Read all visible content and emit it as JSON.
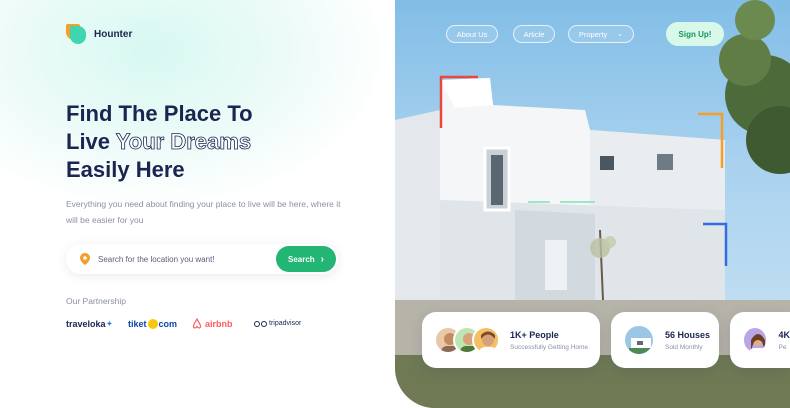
{
  "brand": {
    "name": "Hounter"
  },
  "nav": {
    "items": [
      {
        "label": "About Us"
      },
      {
        "label": "Article"
      },
      {
        "label": "Property"
      }
    ],
    "signup_label": "Sign Up!"
  },
  "hero": {
    "title_line1": "Find The Place To",
    "title_line2_plain": "Live",
    "title_line2_outline": "Your Dreams",
    "title_line3": "Easily Here",
    "description": "Everything you need about finding your place to live will be here, where it will be easier for you"
  },
  "search": {
    "placeholder": "Search for the location you want!",
    "button_label": "Search"
  },
  "partnership": {
    "label": "Our Partnership",
    "partners": [
      "traveloka",
      "tiket",
      "com",
      "airbnb",
      "tripadvisor"
    ]
  },
  "stats": [
    {
      "value": "1K+ People",
      "caption": "Successfully Getting Home"
    },
    {
      "value": "56 Houses",
      "caption": "Sold Monthly"
    },
    {
      "value": "4K",
      "caption": "Pe"
    }
  ],
  "colors": {
    "primary_green": "#22b573",
    "navy": "#1a2552",
    "accent_red": "#e8493f",
    "accent_orange": "#f59e2b",
    "accent_blue": "#2f6fe0"
  }
}
